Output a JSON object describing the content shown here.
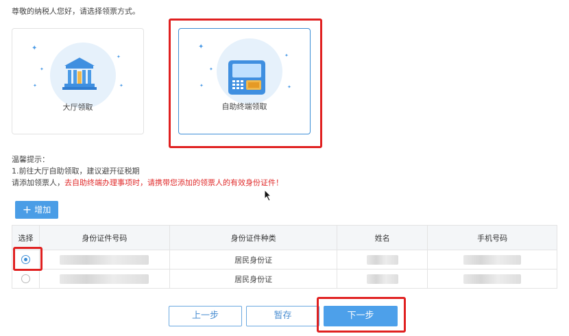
{
  "intro": "尊敬的纳税人您好，请选择领票方式。",
  "options": {
    "hall_label": "大厅领取",
    "self_service_label": "自助终端领取"
  },
  "tips": {
    "title": "温馨提示：",
    "line1": "1.前往大厅自助领取，建议避开征税期",
    "line2_prefix": "请添加领票人，",
    "line2_warning": "去自助终端办理事项时，请携带您添加的领票人的有效身份证件！"
  },
  "add_button": {
    "icon": "plus-icon",
    "label": "增加"
  },
  "table": {
    "headers": [
      "选择",
      "身份证件号码",
      "身份证件种类",
      "姓名",
      "手机号码"
    ],
    "rows": [
      {
        "selected": true,
        "id_type": "居民身份证"
      },
      {
        "selected": false,
        "id_type": "居民身份证"
      }
    ]
  },
  "footer": {
    "prev_label": "上一步",
    "save_label": "暂存",
    "next_label": "下一步"
  },
  "colors": {
    "accent": "#4a9de6",
    "highlight_border": "#e02020",
    "warning_text": "#e02b2b"
  }
}
